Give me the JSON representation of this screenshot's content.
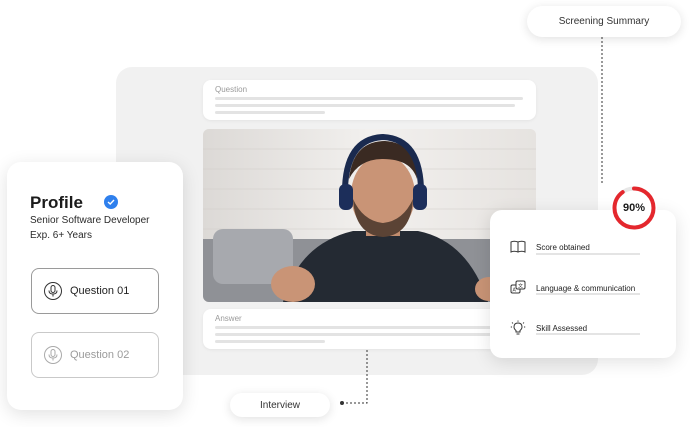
{
  "labels": {
    "screening_summary": "Screening Summary",
    "interview": "Interview",
    "question": "Question",
    "answer": "Answer"
  },
  "profile": {
    "title": "Profile",
    "role": "Senior Software Developer",
    "experience": "Exp. 6+ Years",
    "questions": [
      {
        "label": "Question 01",
        "state": "active"
      },
      {
        "label": "Question 02",
        "state": "inactive"
      }
    ]
  },
  "summary": {
    "score": "90%",
    "score_fraction": 0.9,
    "items": [
      {
        "label": "Score obtained",
        "icon": "book-icon"
      },
      {
        "label": "Language & communication",
        "icon": "translate-icon"
      },
      {
        "label": "Skill Assessed",
        "icon": "lightbulb-icon"
      }
    ]
  },
  "colors": {
    "accent_red": "#e4272d",
    "verified_blue": "#2f80ed"
  }
}
